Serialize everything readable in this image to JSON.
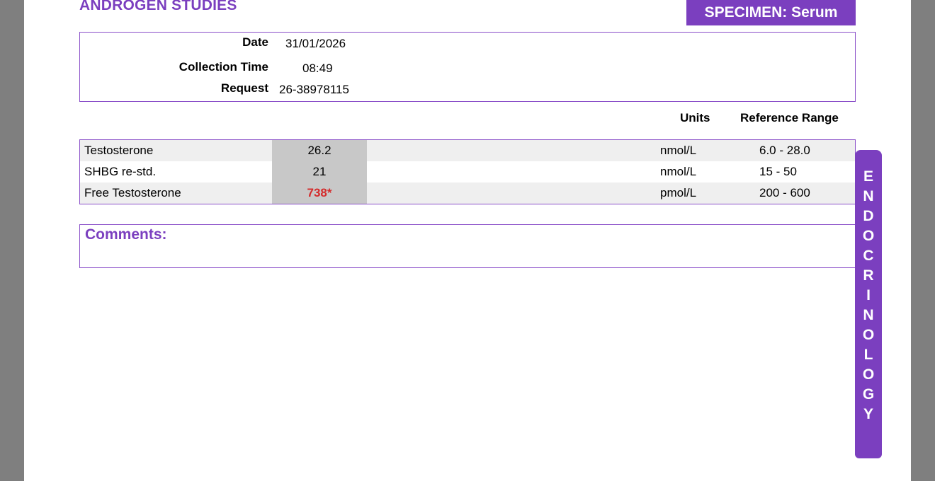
{
  "report": {
    "title": "ANDROGEN STUDIES",
    "specimen": "SPECIMEN: Serum",
    "department_letters": [
      "E",
      "N",
      "D",
      "O",
      "C",
      "R",
      "I",
      "N",
      "O",
      "L",
      "O",
      "G",
      "Y"
    ],
    "colors": {
      "accent": "#7b3fbf",
      "abnormal": "#d42b2b",
      "value_cell": "#c8c8c8",
      "row_shade": "#efefef"
    }
  },
  "info": {
    "date_label": "Date",
    "date_value": "31/01/2026",
    "time_label": "Collection Time",
    "time_value": "08:49",
    "request_label": "Request",
    "request_value": "26-38978115"
  },
  "columns": {
    "units": "Units",
    "reference": "Reference Range"
  },
  "results": [
    {
      "test": "Testosterone",
      "value": "26.2",
      "units": "nmol/L",
      "reference": "6.0 - 28.0"
    },
    {
      "test": "SHBG re-std.",
      "value": "21",
      "units": "nmol/L",
      "reference": "15 - 50"
    },
    {
      "test": "Free Testosterone",
      "value": "738*",
      "units": "pmol/L",
      "reference": "200 - 600"
    }
  ],
  "comments": {
    "label": "Comments:"
  }
}
